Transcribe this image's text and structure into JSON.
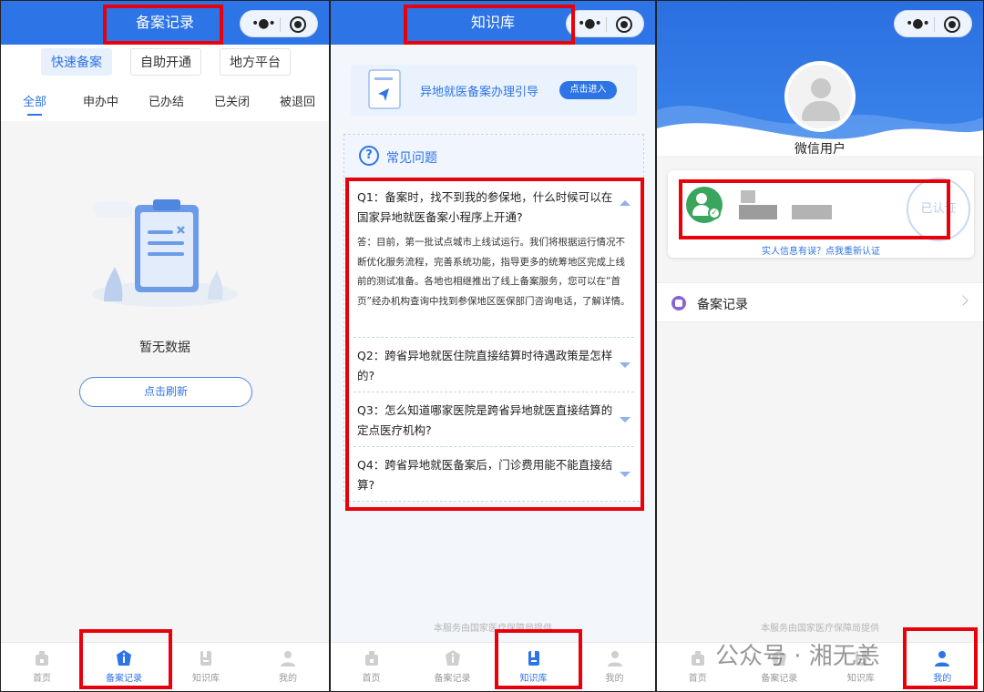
{
  "screen_records": {
    "title": "备案记录",
    "top_buttons": [
      "快速备案",
      "自助开通",
      "地方平台"
    ],
    "status_tabs": [
      "全部",
      "申办中",
      "已办结",
      "已关闭",
      "被退回"
    ],
    "empty_text": "暂无数据",
    "refresh_label": "点击刷新"
  },
  "screen_knowledge": {
    "title": "知识库",
    "guide_text": "异地就医备案办理引导",
    "guide_button": "点击进入",
    "faq_title": "常见问题",
    "faq": [
      {
        "q": "Q1：备案时，找不到我的参保地，什么时候可以在国家异地就医备案小程序上开通?",
        "a": "答：目前，第一批试点城市上线试运行。我们将根据运行情况不断优化服务流程，完善系统功能，指导更多的统筹地区完成上线前的测试准备。各地也相继推出了线上备案服务，您可以在“首页”经办机构查询中找到参保地区医保部门咨询电话，了解详情。"
      },
      {
        "q": "Q2：跨省异地就医住院直接结算时待遇政策是怎样的?",
        "a": ""
      },
      {
        "q": "Q3：怎么知道哪家医院是跨省异地就医直接结算的定点医疗机构?",
        "a": ""
      },
      {
        "q": "Q4：跨省异地就医备案后，门诊费用能不能直接结算?",
        "a": ""
      }
    ],
    "footer": "本服务由国家医疗保障局提供"
  },
  "screen_mine": {
    "nickname": "微信用户",
    "stamp_text": "已认证",
    "reauth": "实人信息有误？点我重新认证",
    "menu_item": "备案记录",
    "footer": "本服务由国家医疗保障局提供"
  },
  "tabbar": [
    "首页",
    "备案记录",
    "知识库",
    "我的"
  ],
  "watermark": "公众号 · 湘无恙",
  "colors": {
    "primary": "#2d74e6",
    "highlight_box": "#e8000b",
    "verified": "#3aa55c"
  }
}
